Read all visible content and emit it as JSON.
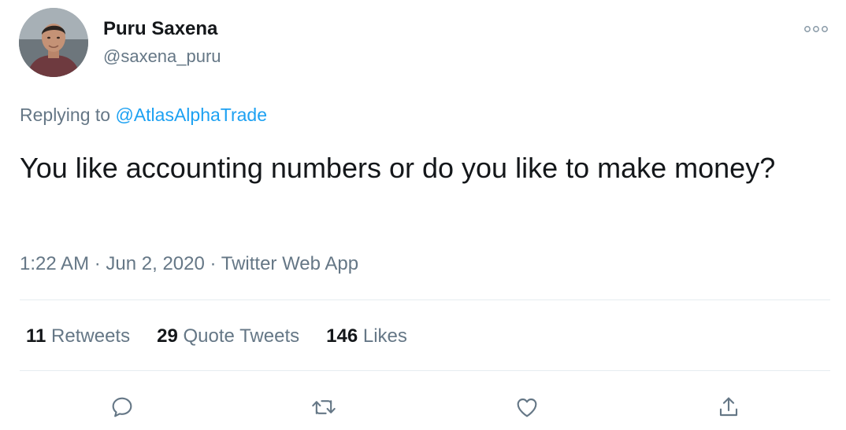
{
  "author": {
    "display_name": "Puru Saxena",
    "handle": "@saxena_puru",
    "avatar_icon": "profile-photo"
  },
  "menu_icon": "more-dots-icon",
  "reply": {
    "prefix": "Replying to",
    "mention": "@AtlasAlphaTrade"
  },
  "tweet": {
    "text": "You like accounting numbers or do you like to make money?"
  },
  "meta": {
    "time": "1:22 AM",
    "separator1": " · ",
    "date": "Jun 2, 2020",
    "separator2": " · ",
    "source": "Twitter Web App"
  },
  "stats": {
    "retweets_count": "11",
    "retweets_label": "Retweets",
    "quotes_count": "29",
    "quotes_label": "Quote Tweets",
    "likes_count": "146",
    "likes_label": "Likes"
  },
  "actions": [
    {
      "icon": "reply-icon"
    },
    {
      "icon": "retweet-icon"
    },
    {
      "icon": "like-icon"
    },
    {
      "icon": "share-icon"
    }
  ],
  "colors": {
    "text": "#14171a",
    "secondary": "#657786",
    "accent": "#1da1f2",
    "divider": "#e6ecf0"
  }
}
